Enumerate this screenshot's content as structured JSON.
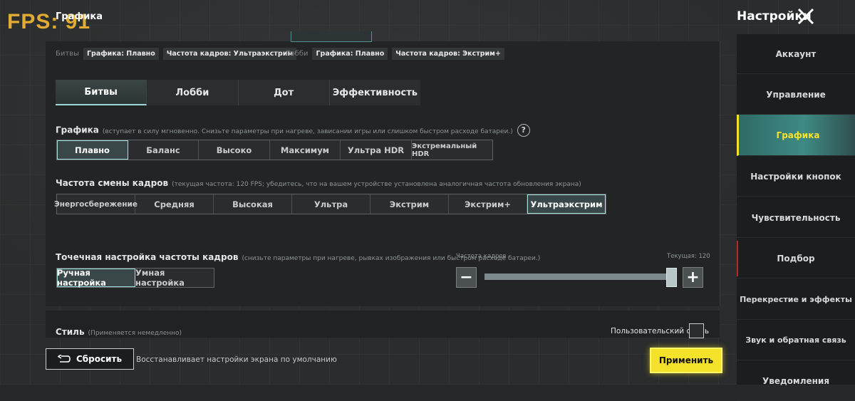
{
  "overlay": {
    "fps": "FPS: 91"
  },
  "header": {
    "breadcrumb": "Графика",
    "title": "Настройки"
  },
  "presets": {
    "battles_label": "Битвы",
    "battles_graphics": "Графика: Плавно",
    "battles_fps": "Частота кадров: Ультраэкстрим",
    "lobby_label": "Лобби",
    "lobby_graphics": "Графика: Плавно",
    "lobby_fps": "Частота кадров: Экстрим+"
  },
  "tabs": [
    {
      "label": "Битвы",
      "active": true
    },
    {
      "label": "Лобби",
      "active": false
    },
    {
      "label": "Дот",
      "active": false
    },
    {
      "label": "Эффективность",
      "active": false
    }
  ],
  "graphics": {
    "title": "Графика",
    "hint": "(вступает в силу мгновенно. Снизьте параметры при нагреве, зависании игры или слишком быстром расходе батареи.)",
    "help_icon": "?",
    "options": [
      "Плавно",
      "Баланс",
      "Высоко",
      "Максимум",
      "Ультра HDR",
      "Экстремальный HDR"
    ],
    "selected": "Плавно"
  },
  "framerate": {
    "title": "Частота смены кадров",
    "hint": "(текущая частота: 120 FPS; убедитесь, что на вашем устройстве установлена аналогичная частота обновления экрана)",
    "options": [
      "Энергосбережение",
      "Средняя",
      "Высокая",
      "Ультра",
      "Экстрим",
      "Экстрим+",
      "Ультраэкстрим"
    ],
    "selected": "Ультраэкстрим"
  },
  "fine_tune": {
    "title": "Точечная настройка частоты кадров",
    "hint": "(снизьте параметры при нагреве, рывках изображения или быстром расходе батареи.)",
    "modes": [
      "Ручная настройка",
      "Умная настройка"
    ],
    "selected_mode": "Ручная настройка",
    "slider_label": "Частота кадров",
    "current_label": "Текущая: 120",
    "slider_value_fraction": 1.0,
    "minus": "−",
    "plus": "+"
  },
  "style": {
    "title": "Стиль",
    "hint": "(Применяется немедленно)",
    "custom_label": "Пользовательский стиль"
  },
  "footer": {
    "reset_label": "Сбросить",
    "reset_desc": "Восстанавливает настройки экрана по умолчанию",
    "apply_label": "Применить"
  },
  "sidebar": {
    "items": [
      {
        "label": "Аккаунт"
      },
      {
        "label": "Управление"
      },
      {
        "label": "Графика",
        "active": true
      },
      {
        "label": "Настройки кнопок"
      },
      {
        "label": "Чувствительность"
      },
      {
        "label": "Подбор"
      },
      {
        "label": "Перекрестие и эффекты"
      },
      {
        "label": "Звук и обратная связь"
      },
      {
        "label": "Уведомления"
      }
    ]
  },
  "colors": {
    "accent": "#a5e0dd",
    "apply": "#f3e12a",
    "fps": "#f2b632"
  }
}
